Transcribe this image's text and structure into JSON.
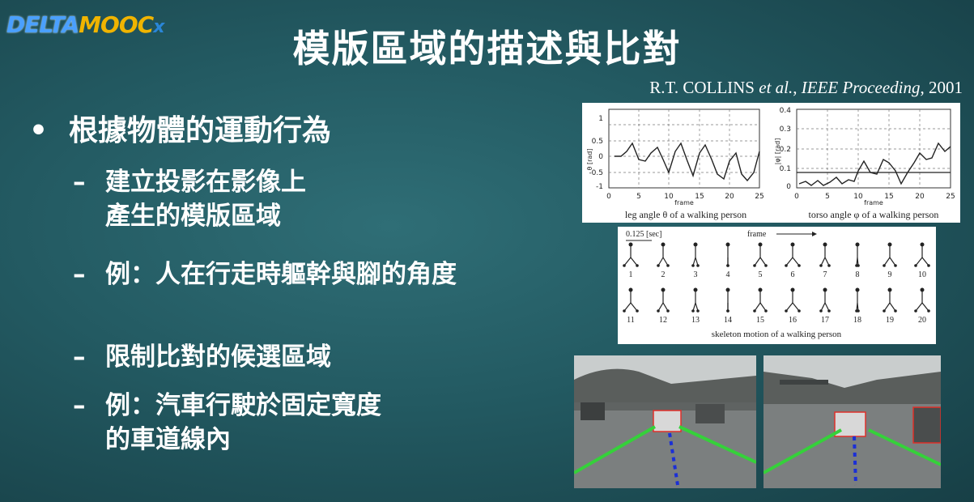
{
  "logo": {
    "delta": "DELTA",
    "mooc": "MOOC",
    "x": "x"
  },
  "title": "模版區域的描述與比對",
  "citation": {
    "authors": "R.T. COLLINS ",
    "etal": "et al.",
    "journal": "IEEE Proceeding",
    "year": ", 2001"
  },
  "bullet": {
    "marker": "•",
    "text": "根據物體的運動行為"
  },
  "items": [
    {
      "dash": "–",
      "text": "建立投影在影像上\n產生的模版區域"
    },
    {
      "dash": "–",
      "text": "例：人在行走時軀幹與腳的角度"
    },
    {
      "dash": "–",
      "text": "限制比對的候選區域"
    },
    {
      "dash": "–",
      "text": "例：汽車行駛於固定寬度\n的車道線內"
    }
  ],
  "plot_left": {
    "ylabel": "θ [rad]",
    "xlabel": "frame",
    "caption": "leg angle θ of a walking person",
    "yticks": [
      "1",
      "0.5",
      "0",
      "-0.5",
      "-1"
    ],
    "xticks": [
      "0",
      "5",
      "10",
      "15",
      "20",
      "25"
    ]
  },
  "plot_right": {
    "ylabel": "|φ| [rad]",
    "xlabel": "frame",
    "caption": "torso angle φ of a walking person",
    "yticks": [
      "0.4",
      "0.3",
      "0.2",
      "0.1",
      "0"
    ],
    "xticks": [
      "0",
      "5",
      "10",
      "15",
      "20",
      "25"
    ]
  },
  "skeleton": {
    "interval": "0.125 [sec]",
    "frame_label": "frame",
    "row1": [
      "1",
      "2",
      "3",
      "4",
      "5",
      "6",
      "7",
      "8",
      "9",
      "10"
    ],
    "row2": [
      "11",
      "12",
      "13",
      "14",
      "15",
      "16",
      "17",
      "18",
      "19",
      "20"
    ],
    "caption": "skeleton motion of a walking person"
  },
  "colors": {
    "background": "#235a62",
    "lane_green": "#35d13a",
    "lane_blue": "#1b2fd6",
    "box_red": "#e0302a"
  }
}
